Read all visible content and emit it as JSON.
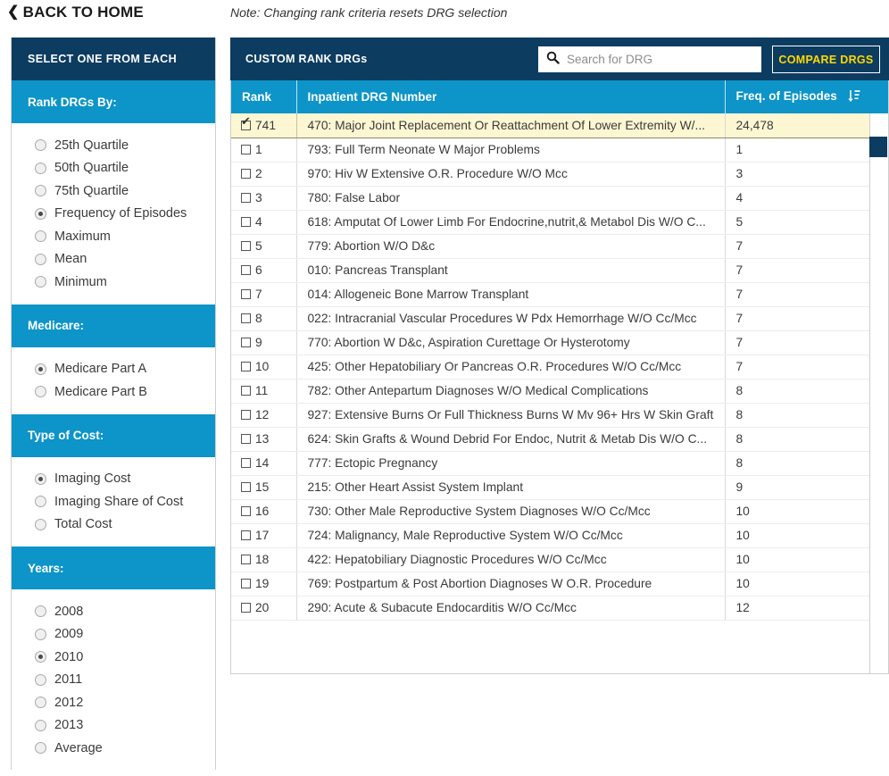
{
  "topbar": {
    "back_label": "BACK TO HOME",
    "back_chevron": "chevron-left-icon",
    "note": "Note: Changing rank criteria resets DRG selection"
  },
  "colors": {
    "navy": "#0d3c61",
    "blue": "#0d94c8",
    "yellow": "#ffd900",
    "highlight_row": "#fcf7d2"
  },
  "sidebar": {
    "title": "SELECT ONE FROM EACH",
    "groups": [
      {
        "heading": "Rank DRGs By:",
        "options": [
          {
            "label": "25th Quartile",
            "selected": false
          },
          {
            "label": "50th Quartile",
            "selected": false
          },
          {
            "label": "75th Quartile",
            "selected": false
          },
          {
            "label": "Frequency of Episodes",
            "selected": true
          },
          {
            "label": "Maximum",
            "selected": false
          },
          {
            "label": "Mean",
            "selected": false
          },
          {
            "label": "Minimum",
            "selected": false
          }
        ]
      },
      {
        "heading": "Medicare:",
        "options": [
          {
            "label": "Medicare Part A",
            "selected": true
          },
          {
            "label": "Medicare Part B",
            "selected": false
          }
        ]
      },
      {
        "heading": "Type of Cost:",
        "options": [
          {
            "label": "Imaging Cost",
            "selected": true
          },
          {
            "label": "Imaging Share of Cost",
            "selected": false
          },
          {
            "label": "Total Cost",
            "selected": false
          }
        ]
      },
      {
        "heading": "Years:",
        "options": [
          {
            "label": "2008",
            "selected": false
          },
          {
            "label": "2009",
            "selected": false
          },
          {
            "label": "2010",
            "selected": true
          },
          {
            "label": "2011",
            "selected": false
          },
          {
            "label": "2012",
            "selected": false
          },
          {
            "label": "2013",
            "selected": false
          },
          {
            "label": "Average",
            "selected": false
          }
        ]
      }
    ]
  },
  "main": {
    "panel_title": "CUSTOM RANK DRGs",
    "search": {
      "placeholder": "Search for DRG",
      "value": "",
      "icon": "search-icon"
    },
    "compare_button": "COMPARE DRGS",
    "table": {
      "columns": [
        "Rank",
        "Inpatient DRG Number",
        "Freq. of Episodes"
      ],
      "sort_icon": "sort-descending-icon",
      "sort_column": "Freq. of Episodes",
      "rows": [
        {
          "rank": "741",
          "checked": true,
          "selected": true,
          "drg": "470: Major Joint Replacement Or Reattachment Of Lower Extremity W/...",
          "freq": "24,478"
        },
        {
          "rank": "1",
          "checked": false,
          "selected": false,
          "drg": "793: Full Term Neonate W Major Problems",
          "freq": "1"
        },
        {
          "rank": "2",
          "checked": false,
          "selected": false,
          "drg": "970: Hiv W Extensive O.R. Procedure W/O Mcc",
          "freq": "3"
        },
        {
          "rank": "3",
          "checked": false,
          "selected": false,
          "drg": "780: False Labor",
          "freq": "4"
        },
        {
          "rank": "4",
          "checked": false,
          "selected": false,
          "drg": "618: Amputat Of Lower Limb For Endocrine,nutrit,& Metabol Dis W/O C...",
          "freq": "5"
        },
        {
          "rank": "5",
          "checked": false,
          "selected": false,
          "drg": "779: Abortion W/O D&c",
          "freq": "7"
        },
        {
          "rank": "6",
          "checked": false,
          "selected": false,
          "drg": "010: Pancreas Transplant",
          "freq": "7"
        },
        {
          "rank": "7",
          "checked": false,
          "selected": false,
          "drg": "014: Allogeneic Bone Marrow Transplant",
          "freq": "7"
        },
        {
          "rank": "8",
          "checked": false,
          "selected": false,
          "drg": "022: Intracranial Vascular Procedures W Pdx Hemorrhage W/O Cc/Mcc",
          "freq": "7"
        },
        {
          "rank": "9",
          "checked": false,
          "selected": false,
          "drg": "770: Abortion W D&c, Aspiration Curettage Or Hysterotomy",
          "freq": "7"
        },
        {
          "rank": "10",
          "checked": false,
          "selected": false,
          "drg": "425: Other Hepatobiliary Or Pancreas O.R. Procedures W/O Cc/Mcc",
          "freq": "7"
        },
        {
          "rank": "11",
          "checked": false,
          "selected": false,
          "drg": "782: Other Antepartum Diagnoses W/O Medical Complications",
          "freq": "8"
        },
        {
          "rank": "12",
          "checked": false,
          "selected": false,
          "drg": "927: Extensive Burns Or Full Thickness Burns W Mv 96+ Hrs W Skin Graft",
          "freq": "8"
        },
        {
          "rank": "13",
          "checked": false,
          "selected": false,
          "drg": "624: Skin Grafts & Wound Debrid For Endoc, Nutrit & Metab Dis W/O C...",
          "freq": "8"
        },
        {
          "rank": "14",
          "checked": false,
          "selected": false,
          "drg": "777: Ectopic Pregnancy",
          "freq": "8"
        },
        {
          "rank": "15",
          "checked": false,
          "selected": false,
          "drg": "215: Other Heart Assist System Implant",
          "freq": "9"
        },
        {
          "rank": "16",
          "checked": false,
          "selected": false,
          "drg": "730: Other Male Reproductive System Diagnoses W/O Cc/Mcc",
          "freq": "10"
        },
        {
          "rank": "17",
          "checked": false,
          "selected": false,
          "drg": "724: Malignancy, Male Reproductive System W/O Cc/Mcc",
          "freq": "10"
        },
        {
          "rank": "18",
          "checked": false,
          "selected": false,
          "drg": "422: Hepatobiliary Diagnostic Procedures W/O Cc/Mcc",
          "freq": "10"
        },
        {
          "rank": "19",
          "checked": false,
          "selected": false,
          "drg": "769: Postpartum & Post Abortion Diagnoses W O.R. Procedure",
          "freq": "10"
        },
        {
          "rank": "20",
          "checked": false,
          "selected": false,
          "drg": "290: Acute & Subacute Endocarditis W/O Cc/Mcc",
          "freq": "12"
        }
      ]
    }
  }
}
